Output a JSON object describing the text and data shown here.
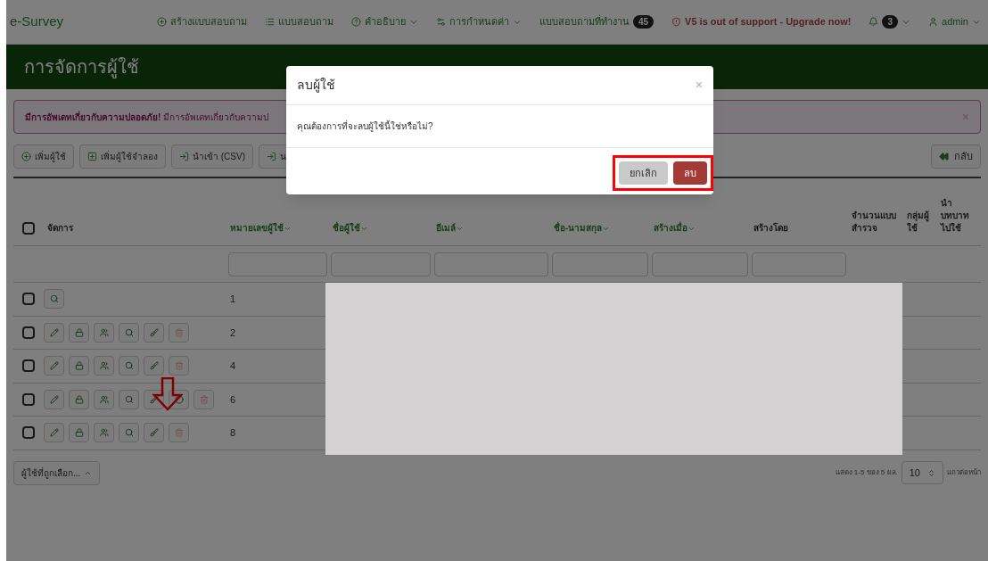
{
  "navbar": {
    "brand": "e-Survey",
    "items": [
      {
        "kind": "link",
        "label": "สร้างแบบสอบถาม"
      },
      {
        "kind": "link",
        "label": "แบบสอบถาม"
      },
      {
        "kind": "dropdown",
        "label": "คำอธิบาย"
      },
      {
        "kind": "dropdown",
        "label": "การกำหนดค่า"
      },
      {
        "kind": "link",
        "label": "แบบสอบถามที่ทำงาน",
        "badge": "45"
      },
      {
        "kind": "warning",
        "label": "V5 is out of support - Upgrade now!"
      },
      {
        "kind": "dropdown",
        "badge": "3"
      },
      {
        "kind": "dropdown",
        "label": "admin"
      }
    ]
  },
  "header": {
    "title": "การจัดการผู้ใช้"
  },
  "alert": {
    "text": "**มีการอัพเดทเกี่ยวกับความปลอดภัย!** มีการอัพเดทเกี่ยวกับความป",
    "close": "×"
  },
  "toolbar": {
    "buttons": [
      {
        "label": "เพิ่มผู้ใช้"
      },
      {
        "label": "เพิ่มผู้ใช้จำลอง"
      },
      {
        "label": "นำเข้า (CSV)"
      },
      {
        "label": "น"
      }
    ],
    "back": "กลับ"
  },
  "table": {
    "columns": [
      {
        "label": "จัดการ",
        "sortable": false
      },
      {
        "label": "หมายเลขผู้ใช้",
        "sortable": true,
        "filter": {
          "kind": "text"
        }
      },
      {
        "label": "ชื่อผู้ใช้",
        "sortable": true,
        "filter": {
          "kind": "text"
        }
      },
      {
        "label": "อีเมล์",
        "sortable": true,
        "filter": {
          "kind": "text"
        }
      },
      {
        "label": "ชื่อ-นามสกุล",
        "sortable": true,
        "filter": {
          "kind": "text"
        }
      },
      {
        "label": "สร้างเมื่อ",
        "sortable": true,
        "filter": {
          "kind": "text"
        }
      },
      {
        "label": "สร้างโดย",
        "sortable": false,
        "filter": {
          "kind": "text"
        }
      },
      {
        "label": "จำนวนแบบสำรวจ",
        "sortable": false
      },
      {
        "label": "กลุ่มผู้ใช้",
        "sortable": false
      },
      {
        "label": "นำบทบาทไปใช้",
        "sortable": false
      }
    ],
    "header_checked": false,
    "rows": [
      {
        "checked": false,
        "id": "1",
        "actions": [
          {
            "kind": "view"
          }
        ],
        "annotated": false
      },
      {
        "checked": false,
        "id": "2",
        "actions": [
          {
            "kind": "edit"
          },
          {
            "kind": "lock"
          },
          {
            "kind": "group"
          },
          {
            "kind": "view"
          },
          {
            "kind": "brush"
          },
          {
            "kind": "delete"
          }
        ],
        "annotated": false
      },
      {
        "checked": false,
        "id": "4",
        "actions": [
          {
            "kind": "edit"
          },
          {
            "kind": "lock"
          },
          {
            "kind": "group"
          },
          {
            "kind": "view"
          },
          {
            "kind": "brush"
          },
          {
            "kind": "delete"
          }
        ],
        "annotated": false
      },
      {
        "checked": false,
        "id": "6",
        "actions": [
          {
            "kind": "edit"
          },
          {
            "kind": "lock"
          },
          {
            "kind": "group"
          },
          {
            "kind": "view"
          },
          {
            "kind": "brush"
          },
          {
            "kind": "other"
          },
          {
            "kind": "delete"
          }
        ],
        "annotated": true
      },
      {
        "checked": false,
        "id": "8",
        "actions": [
          {
            "kind": "edit"
          },
          {
            "kind": "lock"
          },
          {
            "kind": "group"
          },
          {
            "kind": "view"
          },
          {
            "kind": "brush"
          },
          {
            "kind": "delete"
          }
        ],
        "annotated": false
      }
    ],
    "redacted": true
  },
  "footer": {
    "bulk": "ผู้ใช้ที่ถูกเลือก...",
    "info": "แสดง 1-5 ของ 5 ผล.",
    "page_size": "10",
    "page_size_label": "แถวต่อหน้า"
  },
  "modal": {
    "title": "ลบผู้ใช้",
    "close": "×",
    "message": "คุณต้องการที่จะลบผู้ใช้นี้ใช่หรือไม่?",
    "highlighted": true,
    "buttons": [
      {
        "kind": "cancel",
        "label": "ยกเลิก"
      },
      {
        "kind": "danger",
        "label": "ลบ"
      }
    ]
  }
}
